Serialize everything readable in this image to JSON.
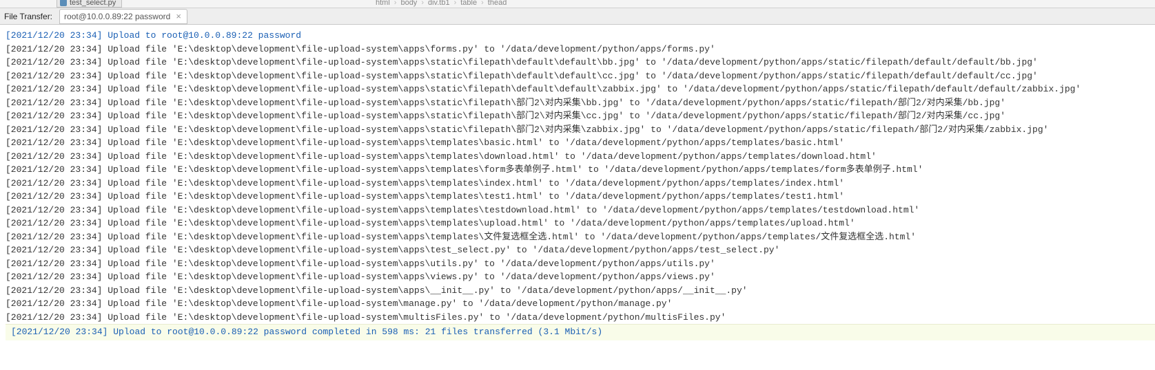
{
  "top": {
    "editor_tab": "test_select.py",
    "breadcrumb": [
      "html",
      "body",
      "div.tb1",
      "table",
      "thead"
    ]
  },
  "file_transfer": {
    "label": "File Transfer:",
    "tab": "root@10.0.0.89:22 password"
  },
  "log": {
    "header_ts": "[2021/12/20 23:34]",
    "header_text": "Upload to root@10.0.0.89:22 password",
    "lines": [
      {
        "ts": "[2021/12/20 23:34]",
        "text": "Upload file 'E:\\desktop\\development\\file-upload-system\\apps\\forms.py' to '/data/development/python/apps/forms.py'"
      },
      {
        "ts": "[2021/12/20 23:34]",
        "text": "Upload file 'E:\\desktop\\development\\file-upload-system\\apps\\static\\filepath\\default\\default\\bb.jpg' to '/data/development/python/apps/static/filepath/default/default/bb.jpg'"
      },
      {
        "ts": "[2021/12/20 23:34]",
        "text": "Upload file 'E:\\desktop\\development\\file-upload-system\\apps\\static\\filepath\\default\\default\\cc.jpg' to '/data/development/python/apps/static/filepath/default/default/cc.jpg'"
      },
      {
        "ts": "[2021/12/20 23:34]",
        "text": "Upload file 'E:\\desktop\\development\\file-upload-system\\apps\\static\\filepath\\default\\default\\zabbix.jpg' to '/data/development/python/apps/static/filepath/default/default/zabbix.jpg'"
      },
      {
        "ts": "[2021/12/20 23:34]",
        "text": "Upload file 'E:\\desktop\\development\\file-upload-system\\apps\\static\\filepath\\部门2\\对内采集\\bb.jpg' to '/data/development/python/apps/static/filepath/部门2/对内采集/bb.jpg'"
      },
      {
        "ts": "[2021/12/20 23:34]",
        "text": "Upload file 'E:\\desktop\\development\\file-upload-system\\apps\\static\\filepath\\部门2\\对内采集\\cc.jpg' to '/data/development/python/apps/static/filepath/部门2/对内采集/cc.jpg'"
      },
      {
        "ts": "[2021/12/20 23:34]",
        "text": "Upload file 'E:\\desktop\\development\\file-upload-system\\apps\\static\\filepath\\部门2\\对内采集\\zabbix.jpg' to '/data/development/python/apps/static/filepath/部门2/对内采集/zabbix.jpg'"
      },
      {
        "ts": "[2021/12/20 23:34]",
        "text": "Upload file 'E:\\desktop\\development\\file-upload-system\\apps\\templates\\basic.html' to '/data/development/python/apps/templates/basic.html'"
      },
      {
        "ts": "[2021/12/20 23:34]",
        "text": "Upload file 'E:\\desktop\\development\\file-upload-system\\apps\\templates\\download.html' to '/data/development/python/apps/templates/download.html'"
      },
      {
        "ts": "[2021/12/20 23:34]",
        "text": "Upload file 'E:\\desktop\\development\\file-upload-system\\apps\\templates\\form多表单例子.html' to '/data/development/python/apps/templates/form多表单例子.html'"
      },
      {
        "ts": "[2021/12/20 23:34]",
        "text": "Upload file 'E:\\desktop\\development\\file-upload-system\\apps\\templates\\index.html' to '/data/development/python/apps/templates/index.html'"
      },
      {
        "ts": "[2021/12/20 23:34]",
        "text": "Upload file 'E:\\desktop\\development\\file-upload-system\\apps\\templates\\test1.html' to '/data/development/python/apps/templates/test1.html'"
      },
      {
        "ts": "[2021/12/20 23:34]",
        "text": "Upload file 'E:\\desktop\\development\\file-upload-system\\apps\\templates\\testdownload.html' to '/data/development/python/apps/templates/testdownload.html'"
      },
      {
        "ts": "[2021/12/20 23:34]",
        "text": "Upload file 'E:\\desktop\\development\\file-upload-system\\apps\\templates\\upload.html' to '/data/development/python/apps/templates/upload.html'"
      },
      {
        "ts": "[2021/12/20 23:34]",
        "text": "Upload file 'E:\\desktop\\development\\file-upload-system\\apps\\templates\\文件复选框全选.html' to '/data/development/python/apps/templates/文件复选框全选.html'"
      },
      {
        "ts": "[2021/12/20 23:34]",
        "text": "Upload file 'E:\\desktop\\development\\file-upload-system\\apps\\test_select.py' to '/data/development/python/apps/test_select.py'"
      },
      {
        "ts": "[2021/12/20 23:34]",
        "text": "Upload file 'E:\\desktop\\development\\file-upload-system\\apps\\utils.py' to '/data/development/python/apps/utils.py'"
      },
      {
        "ts": "[2021/12/20 23:34]",
        "text": "Upload file 'E:\\desktop\\development\\file-upload-system\\apps\\views.py' to '/data/development/python/apps/views.py'"
      },
      {
        "ts": "[2021/12/20 23:34]",
        "text": "Upload file 'E:\\desktop\\development\\file-upload-system\\apps\\__init__.py' to '/data/development/python/apps/__init__.py'"
      },
      {
        "ts": "[2021/12/20 23:34]",
        "text": "Upload file 'E:\\desktop\\development\\file-upload-system\\manage.py' to '/data/development/python/manage.py'"
      },
      {
        "ts": "[2021/12/20 23:34]",
        "text": "Upload file 'E:\\desktop\\development\\file-upload-system\\multisFiles.py' to '/data/development/python/multisFiles.py'"
      }
    ],
    "footer_ts": "[2021/12/20 23:34]",
    "footer_text": "Upload to root@10.0.0.89:22 password completed in 598 ms: 21 files transferred (3.1 Mbit/s)"
  }
}
